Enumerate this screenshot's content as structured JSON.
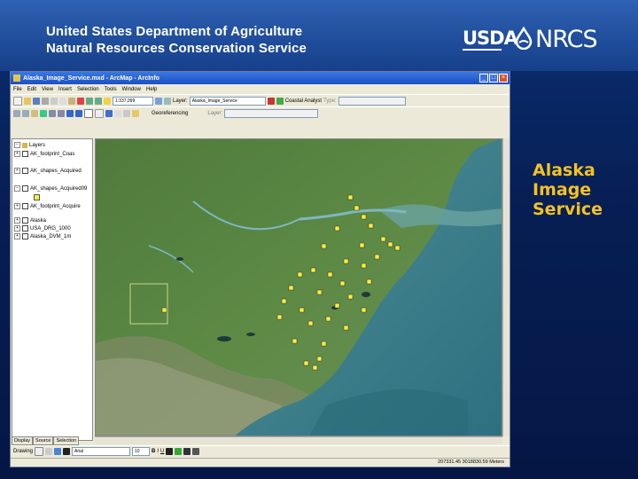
{
  "header": {
    "line1": "United States Department of Agriculture",
    "line2": "Natural Resources Conservation Service",
    "logo_usda": "USDA",
    "logo_nrcs": "NRCS"
  },
  "slide_title": [
    "Alaska",
    "Image",
    "Service"
  ],
  "colors": {
    "banner": "#1f4c9a",
    "background": "#071f55",
    "title_accent": "#f4c222",
    "footprint_symbol": "#ffef3a"
  },
  "app": {
    "title": "Alaska_Image_Service.mxd - ArcMap - ArcInfo",
    "menu": [
      "File",
      "Edit",
      "View",
      "Insert",
      "Selection",
      "Tools",
      "Window",
      "Help"
    ],
    "toolbar": {
      "scale": "1:337,099",
      "layer_label": "Layer:",
      "layer_value": "Alaska_Image_Service",
      "coastal_label": "Coastal Analyst",
      "type_label": "Type:",
      "georef_label": "Georeferencing",
      "layer2_label": "Layer:"
    },
    "toc": {
      "root": "Layers",
      "layers": [
        "AK_footprint_Coas",
        "AK_shapes_Acquired",
        "AK_shapes_Acquired09",
        "AK_footprint_Acquire",
        "Alaska",
        "USA_DRG_1000",
        "Alaska_DVM_1m"
      ],
      "tabs": [
        "Display",
        "Source",
        "Selection"
      ]
    },
    "drawing": {
      "label": "Drawing",
      "font": "Arial",
      "size": "10"
    },
    "status": "207331.45   3018830.59 Meters"
  },
  "map_markers_count": 35
}
